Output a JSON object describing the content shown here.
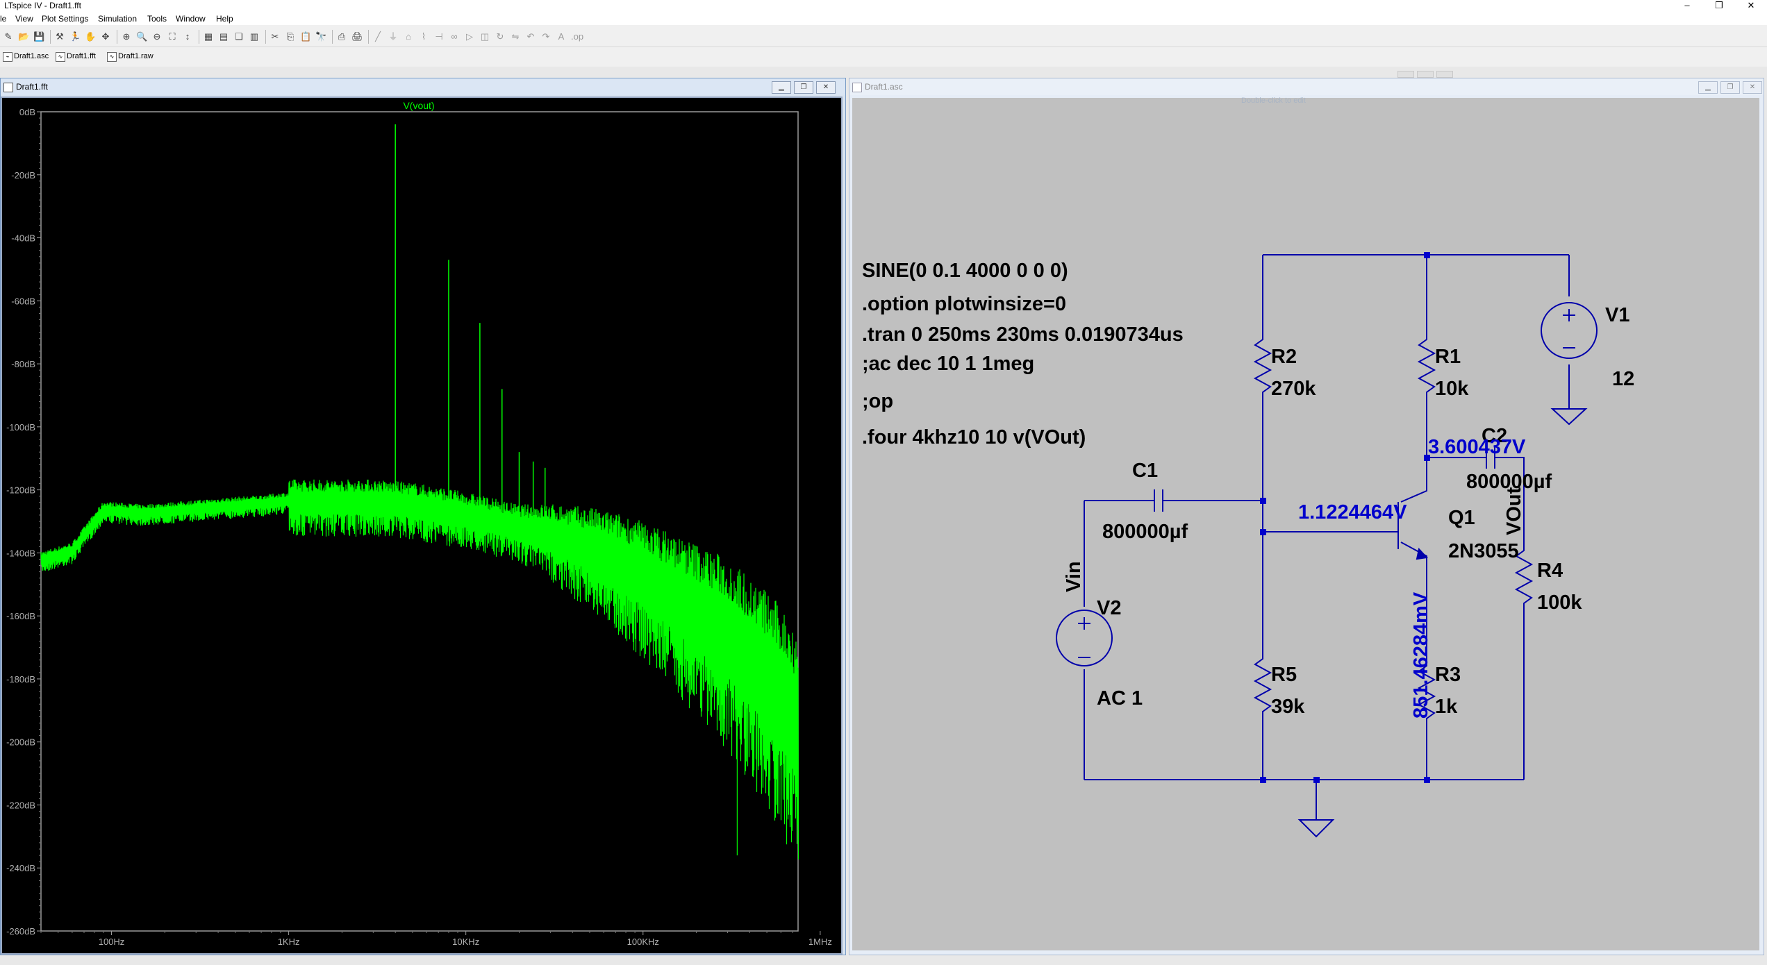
{
  "app": {
    "title": "LTspice IV - Draft1.fft",
    "window_controls": [
      "–",
      "❐",
      "✕"
    ]
  },
  "menu": [
    "le",
    "View",
    "Plot Settings",
    "Simulation",
    "Tools",
    "Window",
    "Help"
  ],
  "toolbar_icons": [
    "new-schematic-icon",
    "open-icon",
    "save-icon",
    "control-panel-icon",
    "run-icon",
    "halt-icon",
    "pan-icon",
    "zoom-in-icon",
    "zoom-box-icon",
    "zoom-out-icon",
    "zoom-fit-icon",
    "autorange-icon",
    "grid-icon",
    "tile-horizontal-icon",
    "cascade-icon",
    "tile-vertical-icon",
    "cut-icon",
    "copy-icon",
    "paste-icon",
    "find-icon",
    "print-setup-icon",
    "print-icon",
    "wire-icon",
    "ground-icon",
    "label-icon",
    "resistor-icon",
    "capacitor-icon",
    "inductor-icon",
    "diode-icon",
    "component-icon",
    "rotate-icon",
    "mirror-icon",
    "undo-icon",
    "redo-icon",
    "text-icon",
    "spice-directive-icon"
  ],
  "tabs": [
    {
      "label": "Draft1.asc",
      "icon": "schematic-file-icon"
    },
    {
      "label": "Draft1.fft",
      "icon": "fft-file-icon"
    },
    {
      "label": "Draft1.raw",
      "icon": "waveform-file-icon"
    }
  ],
  "fft_window": {
    "title": "Draft1.fft",
    "trace_label": "V(vout)",
    "trace_color": "#00ff00",
    "background": "#000000"
  },
  "schematic_window": {
    "title": "Draft1.asc",
    "faded_overlay_text": "Double-click to edit"
  },
  "schematic": {
    "directives": [
      "SINE(0 0.1 4000 0 0 0)",
      ".option plotwinsize=0",
      ".tran 0 250ms 230ms 0.0190734us",
      ";ac dec 10 1 1meg",
      ";op",
      ".four 4khz10 10 v(VOut)"
    ],
    "components": {
      "V1": {
        "name": "V1",
        "value": "12"
      },
      "V2": {
        "name": "V2",
        "value": "AC 1"
      },
      "R1": {
        "name": "R1",
        "value": "10k"
      },
      "R2": {
        "name": "R2",
        "value": "270k"
      },
      "R3": {
        "name": "R3",
        "value": "1k"
      },
      "R4": {
        "name": "R4",
        "value": "100k"
      },
      "R5": {
        "name": "R5",
        "value": "39k"
      },
      "C1": {
        "name": "C1",
        "value": "800000µf"
      },
      "C2": {
        "name": "C2",
        "value": "800000µf"
      },
      "Q1": {
        "name": "Q1",
        "value": "2N3055"
      }
    },
    "net_labels": {
      "vin": "Vin",
      "vout": "VOut"
    },
    "op_annotations": {
      "base": "1.1224464V",
      "collector": "3.600437V",
      "emitter": "851.46284mV"
    },
    "wire_color": "#0000aa",
    "annotation_color": "#0000cc",
    "background": "#c0c0c0"
  },
  "chart_data": {
    "type": "line",
    "title": "V(vout)",
    "xlabel": "",
    "ylabel": "",
    "x_scale": "log",
    "x_range_hz": [
      40,
      750000
    ],
    "ylim": [
      -260,
      0
    ],
    "y_unit": "dB",
    "y_tick_labels": [
      "0dB",
      "-20dB",
      "-40dB",
      "-60dB",
      "-80dB",
      "-100dB",
      "-120dB",
      "-140dB",
      "-160dB",
      "-180dB",
      "-200dB",
      "-220dB",
      "-240dB",
      "-260dB"
    ],
    "x_tick_labels": [
      "100Hz",
      "1KHz",
      "10KHz",
      "100KHz",
      "1MHz"
    ],
    "grid": false,
    "series": [
      {
        "name": "V(vout)",
        "color": "#00ff00",
        "x": [
          40,
          60,
          90,
          150,
          250,
          400,
          700,
          1000,
          1500,
          2000,
          3000,
          5000,
          8000,
          12000,
          20000,
          30000,
          50000,
          80000,
          120000,
          200000,
          300000,
          500000,
          750000
        ],
        "noise_floor_db": [
          -142,
          -139,
          -126,
          -127,
          -126,
          -125,
          -124,
          -123,
          -123,
          -123,
          -123,
          -124,
          -126,
          -128,
          -131,
          -133,
          -137,
          -142,
          -148,
          -156,
          -163,
          -176,
          -190
        ],
        "harmonics": [
          {
            "freq_hz": 4000,
            "db": -4
          },
          {
            "freq_hz": 8000,
            "db": -47
          },
          {
            "freq_hz": 12000,
            "db": -67
          },
          {
            "freq_hz": 16000,
            "db": -88
          },
          {
            "freq_hz": 20000,
            "db": -108
          },
          {
            "freq_hz": 24000,
            "db": -111
          },
          {
            "freq_hz": 28000,
            "db": -113
          }
        ],
        "dips": [
          {
            "freq_hz": 340000,
            "db": -236
          }
        ]
      }
    ]
  }
}
